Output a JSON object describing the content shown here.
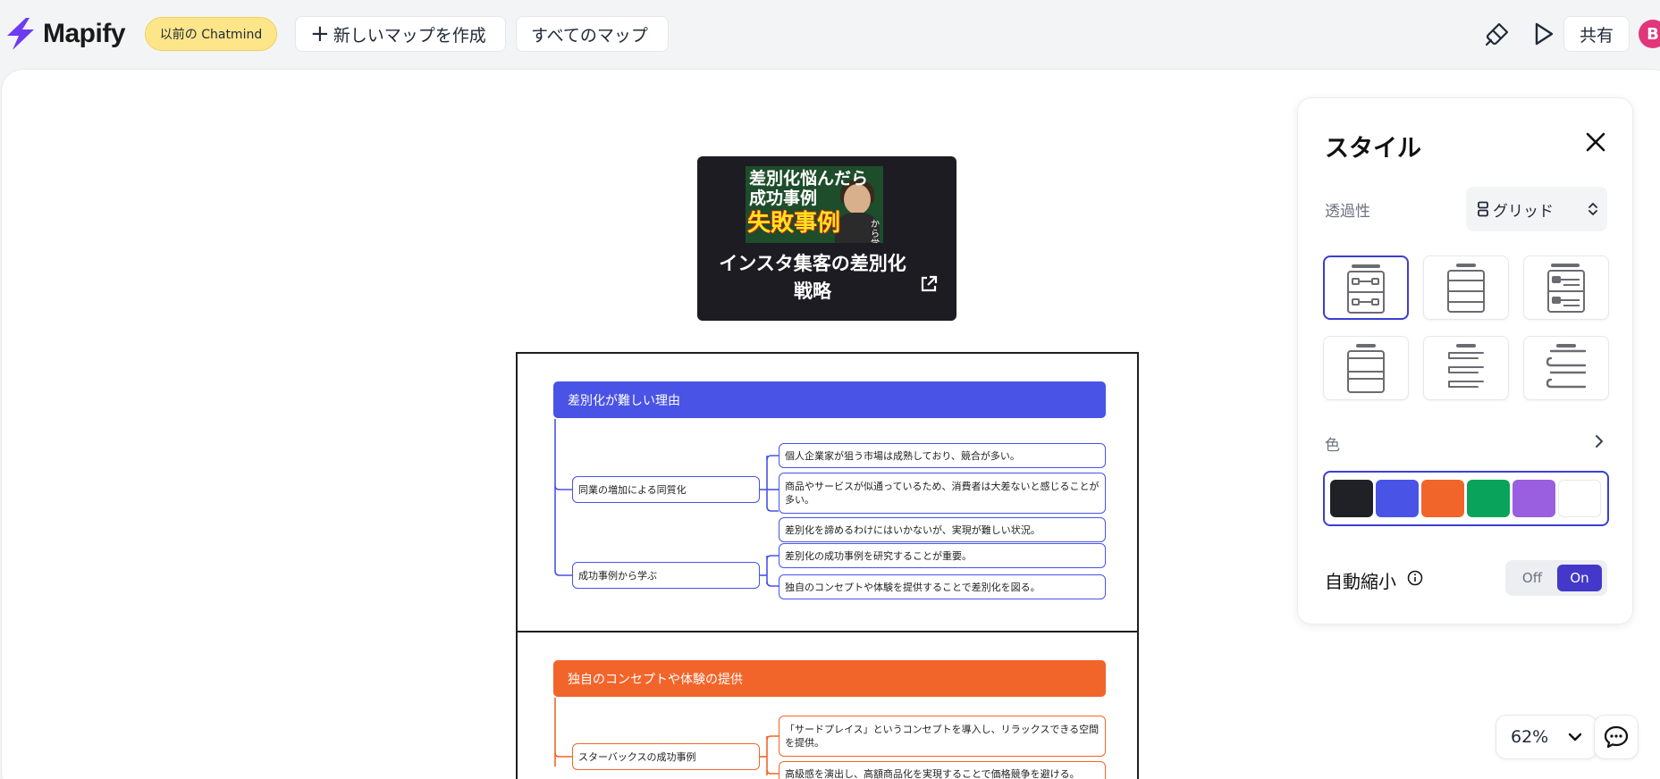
{
  "app": {
    "name": "Mapify"
  },
  "toolbar": {
    "legacy_label": "以前の Chatmind",
    "new_map_label": "新しいマップを作成",
    "all_maps_label": "すべてのマップ",
    "share_label": "共有",
    "avatar_initial": "B"
  },
  "map": {
    "root": {
      "title": "インスタ集客の差別化戦略",
      "thumbnail_lines": [
        "差別化悩んだら",
        "成功事例",
        "失敗事例",
        "から学ぶ"
      ]
    },
    "sections": [
      {
        "title": "差別化が難しい理由",
        "color": "#4953e6",
        "branches": [
          {
            "label": "同業の増加による同質化",
            "leaves": [
              "個人企業家が狙う市場は成熟しており、競合が多い。",
              "商品やサービスが似通っているため、消費者は大差ないと感じることが多い。",
              "差別化を諦めるわけにはいかないが、実現が難しい状況。"
            ]
          },
          {
            "label": "成功事例から学ぶ",
            "leaves": [
              "差別化の成功事例を研究することが重要。",
              "独自のコンセプトや体験を提供することで差別化を図る。"
            ]
          }
        ]
      },
      {
        "title": "独自のコンセプトや体験の提供",
        "color": "#f2652a",
        "branches": [
          {
            "label": "スターバックスの成功事例",
            "leaves": [
              "「サードプレイス」というコンセプトを導入し、リラックスできる空間を提供。",
              "高級感を演出し、高額商品化を実現することで価格競争を避ける。"
            ]
          }
        ]
      }
    ]
  },
  "style_panel": {
    "title": "スタイル",
    "opacity_label": "透過性",
    "layout_select_value": "グリッド",
    "color_label": "色",
    "colors": [
      "#1f2127",
      "#4953e6",
      "#f2652a",
      "#0aa35b",
      "#9a5ee0",
      "#ffffff"
    ],
    "auto_shrink_label": "自動縮小",
    "toggle_off": "Off",
    "toggle_on": "On",
    "auto_shrink_enabled": true
  },
  "zoom": {
    "value": "62%"
  }
}
